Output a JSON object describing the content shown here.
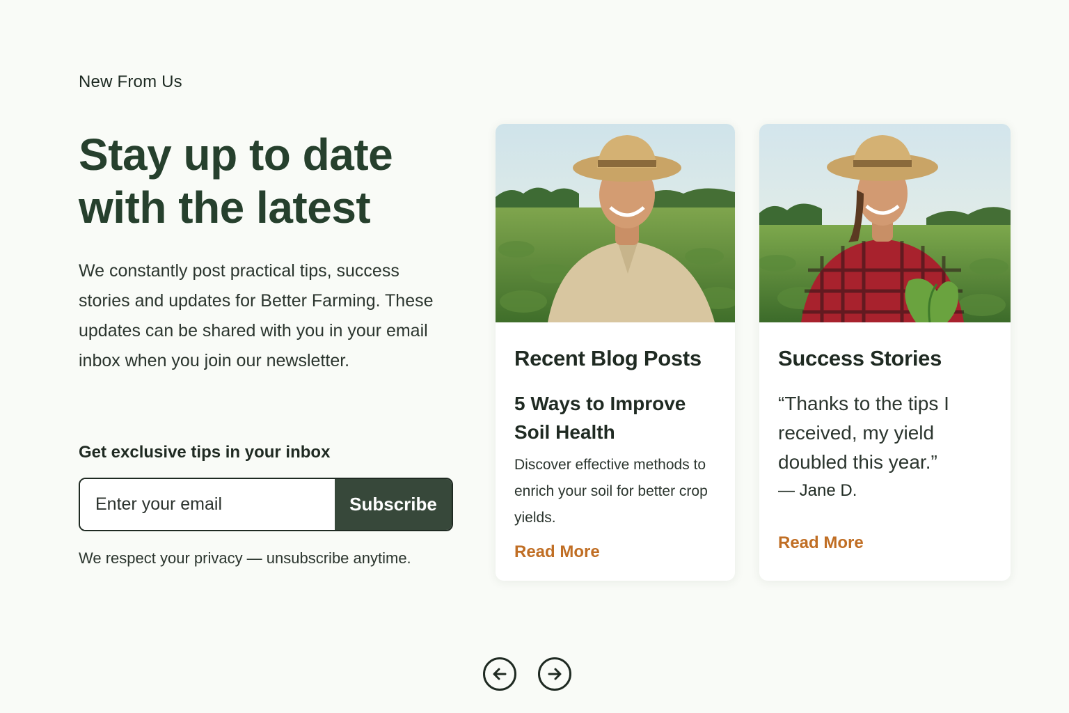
{
  "section": {
    "eyebrow": "New From Us",
    "headline": "Stay up to date with the latest",
    "body": "We constantly post practical tips, success stories and updates for Better Farming. These updates can be shared with you in your email inbox when you join our newsletter."
  },
  "newsletter": {
    "label": "Get exclusive tips in your inbox",
    "email_placeholder": "Enter your email",
    "email_value": "",
    "subscribe_label": "Subscribe",
    "privacy_note": "We respect your privacy — unsubscribe anytime."
  },
  "cards": [
    {
      "title": "Recent Blog Posts",
      "subtitle": "5 Ways to Improve Soil Health",
      "description": "Discover effective methods to enrich your soil for better crop yields.",
      "link_label": "Read More",
      "image": "farmer-man-straw-hat-field-photo"
    },
    {
      "title": "Success Stories",
      "quote": "“Thanks to the tips I received, my yield doubled this year.”",
      "author": "— Jane D.",
      "link_label": "Read More",
      "image": "farmer-woman-straw-hat-field-photo"
    }
  ],
  "carousel": {
    "prev_icon": "arrow-left-circle-icon",
    "next_icon": "arrow-right-circle-icon"
  },
  "colors": {
    "background": "#f9fbf7",
    "heading": "#26402d",
    "button": "#37483a",
    "link": "#c06e24"
  }
}
